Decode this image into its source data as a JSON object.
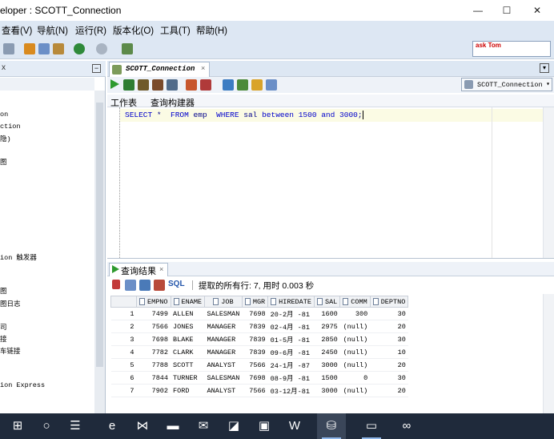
{
  "window": {
    "title": "eloper : SCOTT_Connection",
    "controls": {
      "minimize": "—",
      "maximize": "☐",
      "close": "✕"
    }
  },
  "menubar": {
    "items": [
      "查看(V)",
      "导航(N)",
      "运行(R)",
      "版本化(O)",
      "工具(T)",
      "帮助(H)"
    ]
  },
  "toolbar": {
    "ask_tom_label": "ask Tom"
  },
  "left_panel": {
    "tab_close": "x",
    "minimize": "−",
    "items": [
      "on",
      "ction",
      "隐)",
      "图",
      "ion 触发器",
      "图",
      "图日志",
      "司",
      "接",
      "车链接",
      "ion Express"
    ]
  },
  "editor": {
    "tab_label": "SCOTT_Connection",
    "tab_close": "×",
    "connection_select": "SCOTT_Connection",
    "subtabs": [
      "工作表",
      "查询构建器"
    ],
    "sql": {
      "select": "SELECT",
      "star": "*",
      "from": "FROM",
      "table": "emp",
      "where": "WHERE",
      "column": "sal",
      "between": "between",
      "low": "1500",
      "and": "and",
      "high": "3000",
      "terminator": ";"
    }
  },
  "results": {
    "tab_label": "查询结果",
    "tab_close": "×",
    "sql_button": "SQL",
    "status_text": "提取的所有行: 7, 用时 0.003 秒",
    "columns": [
      "EMPNO",
      "ENAME",
      "JOB",
      "MGR",
      "HIREDATE",
      "SAL",
      "COMM",
      "DEPTNO"
    ],
    "rows": [
      [
        "1",
        "7499",
        "ALLEN",
        "SALESMAN",
        "7698",
        "20-2月 -81",
        "1600",
        "300",
        "30"
      ],
      [
        "2",
        "7566",
        "JONES",
        "MANAGER",
        "7839",
        "02-4月 -81",
        "2975",
        "(null)",
        "20"
      ],
      [
        "3",
        "7698",
        "BLAKE",
        "MANAGER",
        "7839",
        "01-5月 -81",
        "2850",
        "(null)",
        "30"
      ],
      [
        "4",
        "7782",
        "CLARK",
        "MANAGER",
        "7839",
        "09-6月 -81",
        "2450",
        "(null)",
        "10"
      ],
      [
        "5",
        "7788",
        "SCOTT",
        "ANALYST",
        "7566",
        "24-1月 -87",
        "3000",
        "(null)",
        "20"
      ],
      [
        "6",
        "7844",
        "TURNER",
        "SALESMAN",
        "7698",
        "08-9月 -81",
        "1500",
        "0",
        "30"
      ],
      [
        "7",
        "7902",
        "FORD",
        "ANALYST",
        "7566",
        "03-12月-81",
        "3000",
        "(null)",
        "20"
      ]
    ]
  },
  "taskbar": {
    "apps": [
      {
        "icon": "windows-start-icon",
        "glyph": "⊞"
      },
      {
        "icon": "search-circle-icon",
        "glyph": "○"
      },
      {
        "icon": "task-view-icon",
        "glyph": "☰"
      },
      {
        "icon": "edge-browser-icon",
        "glyph": "e"
      },
      {
        "icon": "visual-studio-icon",
        "glyph": "⋈"
      },
      {
        "icon": "file-explorer-icon",
        "glyph": "▬"
      },
      {
        "icon": "mail-icon",
        "glyph": "✉"
      },
      {
        "icon": "feedback-icon",
        "glyph": "◪"
      },
      {
        "icon": "app-icon",
        "glyph": "▣"
      },
      {
        "icon": "wps-icon",
        "glyph": "W"
      },
      {
        "icon": "sql-developer-icon",
        "glyph": "⛁"
      },
      {
        "icon": "window-app-icon",
        "glyph": "▭"
      },
      {
        "icon": "baidu-netdisk-icon",
        "glyph": "∞"
      }
    ]
  }
}
